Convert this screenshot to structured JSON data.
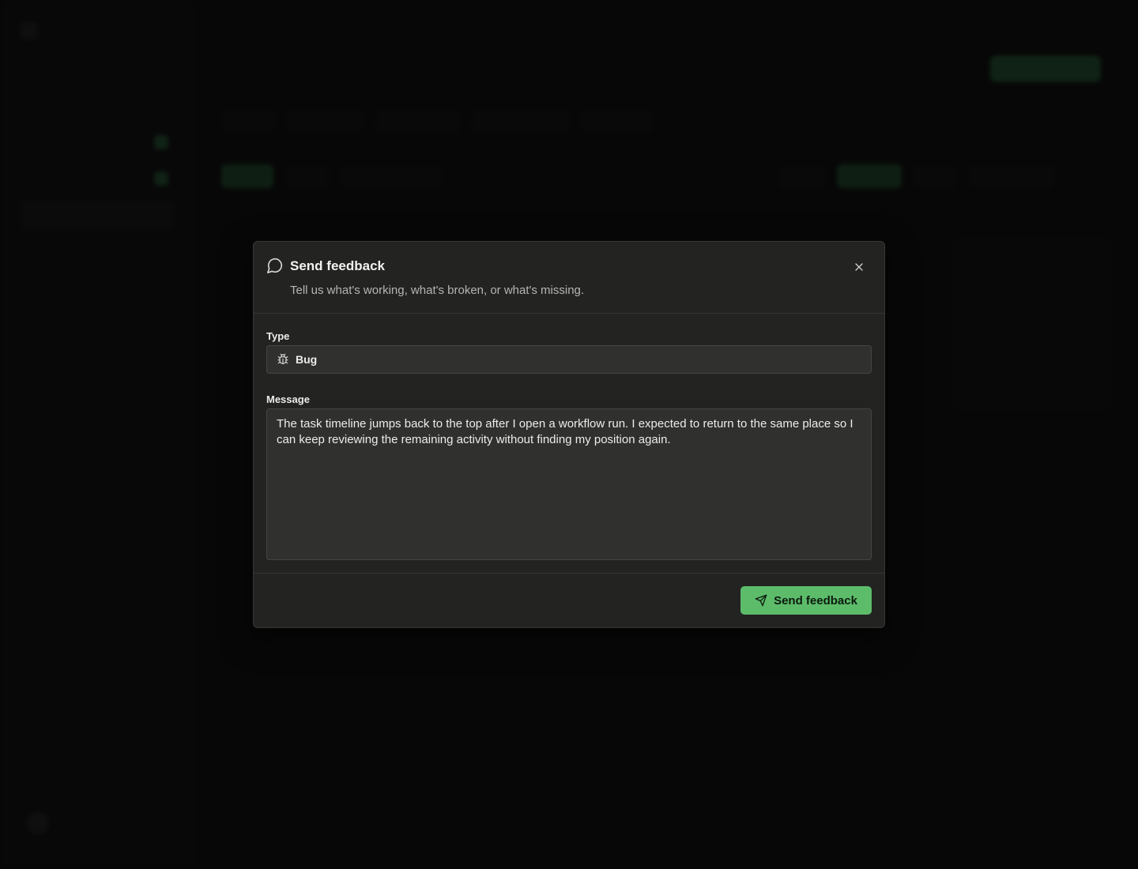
{
  "background": {
    "brand_name": "",
    "page_title": "",
    "sidebar_items": [
      "",
      "",
      "",
      "",
      ""
    ],
    "tabs": [
      "",
      "",
      "",
      "",
      ""
    ]
  },
  "modal": {
    "title": "Send feedback",
    "subtitle": "Tell us what's working, what's broken, or what's missing.",
    "title_icon": "message-circle-icon",
    "close_icon": "close-icon",
    "type_field": {
      "label": "Type",
      "value": "Bug",
      "icon": "bug-icon"
    },
    "message_field": {
      "label": "Message",
      "value": "The task timeline jumps back to the top after I open a workflow run. I expected to return to the same place so I can keep reviewing the remaining activity without finding my position again."
    },
    "submit": {
      "label": "Send feedback",
      "icon": "send-icon"
    },
    "colors": {
      "accent": "#5cbc6a",
      "surface": "#232322",
      "input": "#30302e"
    }
  }
}
